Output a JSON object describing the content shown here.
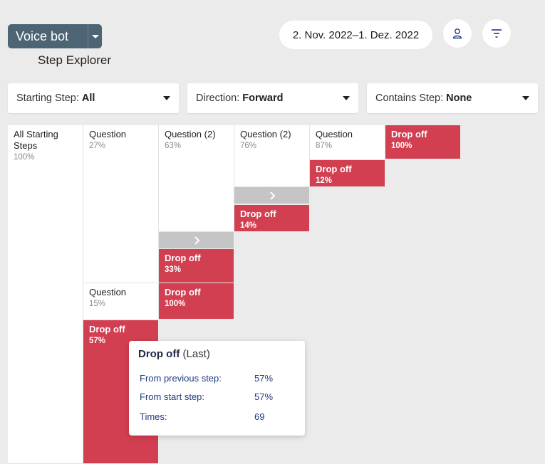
{
  "header": {
    "bot_selector_label": "Voice bot",
    "page_title": "Step Explorer",
    "date_range": "2. Nov. 2022–1. Dez. 2022",
    "user_icon": "user-icon",
    "filter_icon": "filter-icon"
  },
  "filters": [
    {
      "key": "Starting Step:",
      "value": "All"
    },
    {
      "key": "Direction:",
      "value": "Forward"
    },
    {
      "key": "Contains Step:",
      "value": "None"
    }
  ],
  "explorer": {
    "start": {
      "name": "All Starting Steps",
      "pct": "100%"
    },
    "col1": [
      {
        "name": "Question",
        "pct": "27%"
      },
      {
        "name": "Question",
        "pct": "15%"
      },
      {
        "name": "Drop off",
        "pct": "57%"
      }
    ],
    "col2": [
      {
        "name": "Question (2)",
        "pct": "63%"
      },
      {
        "name": "Drop off",
        "pct": "33%"
      },
      {
        "name": "Drop off",
        "pct": "100%"
      }
    ],
    "col3": [
      {
        "name": "Question (2)",
        "pct": "76%"
      },
      {
        "name": "Drop off",
        "pct": "14%"
      }
    ],
    "col4": [
      {
        "name": "Question",
        "pct": "87%"
      },
      {
        "name": "Drop off",
        "pct": "12%"
      }
    ],
    "col5": [
      {
        "name": "Drop off",
        "pct": "100%"
      }
    ]
  },
  "tooltip": {
    "title": "Drop off",
    "subtitle": "(Last)",
    "rows": [
      {
        "label": "From previous step:",
        "value": "57%"
      },
      {
        "label": "From start step:",
        "value": "57%"
      },
      {
        "label": "Times:",
        "value": "69"
      }
    ]
  },
  "colors": {
    "dropoff": "#d23f51",
    "primary": "#4c6474",
    "accent": "#203a80"
  }
}
